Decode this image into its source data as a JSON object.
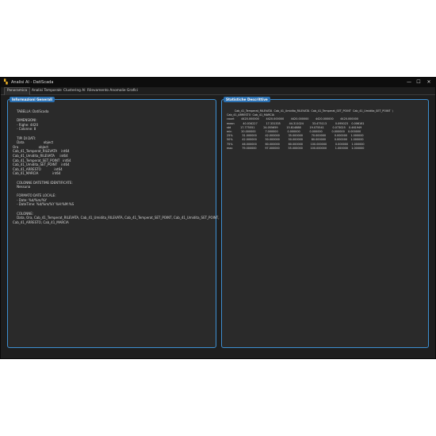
{
  "window": {
    "title": "Analisi AI - DatiScada",
    "icon": "app-logo-icon",
    "controls": {
      "minimize": "—",
      "maximize": "☐",
      "close": "✕"
    }
  },
  "tabs": [
    {
      "label": "Panoramica"
    },
    {
      "label": "Analisi Temporale"
    },
    {
      "label": "Clustering AI"
    },
    {
      "label": "Rilevamento Anomalie"
    },
    {
      "label": "Grafici"
    }
  ],
  "left_panel": {
    "title": "Informazioni Generali",
    "text": "    TABELLA: DatiScada\n\n    DIMENSIONI:\n    - Righe: 4420\n    - Colonne: 8\n\n    TIPI DI DATI:\n    Data                   object\nOra                    object\nCab_41_Temperat_RILEVATA    int64\nCab_41_Umidita_RILEVATA     int64\nCab_41_Temperat_SET_POINT   int64\nCab_41_Umidita_SET_POINT    int64\nCab_41_ARRESTO             int64\nCab_41_MARCIA              int64\n\n    COLONNE DATETIME IDENTIFICATE:\n    Nessuna\n\n    FORMATO DATE LOCALE:\n    - Date: %d/%m/%Y\n    - DateTime: %d/%m/%Y %H:%M:%S\n\n    COLONNE:\n    Data, Ora, Cab_41_Temperat_RILEVATA, Cab_41_Umidita_RILEVATA, Cab_41_Temperat_SET_POINT, Cab_41_Umidita_SET_POINT,\nCab_41_ARRESTO, Cab_41_MARCIA"
  },
  "right_panel": {
    "title": "Statistiche Descrittive",
    "text": "         Cab_41_Temperat_RILEVATA  Cab_41_Umidita_RILEVATA  Cab_41_Temperat_SET_POINT  Cab_41_Umidita_SET_POINT  \\\nCab_41_ARRESTO  Cab_41_MARCIA\ncount        4420.000000        4420.000000        4420.000000        4420.000000        4420.000000\nmean          40.034227          17.331335          44.311024          33.475113          0.095023    0.006181\nstd           17.775551          24.055659          15.814888          19.075541          0.073025    0.461949\nmin           20.000000           7.000000           0.000000           0.000000           0.000000    0.000000\n25%           31.000000          42.000000          35.000000          70.000000          0.000000    1.000000\n50%           42.000000          50.000000          50.000000          80.000000          0.000000    1.000000\n75%           46.000000          60.000000          60.000000         100.000000          0.000000    1.000000\nmax           79.000000          97.000000          55.000000         100.000000          1.000000    1.000000"
  }
}
